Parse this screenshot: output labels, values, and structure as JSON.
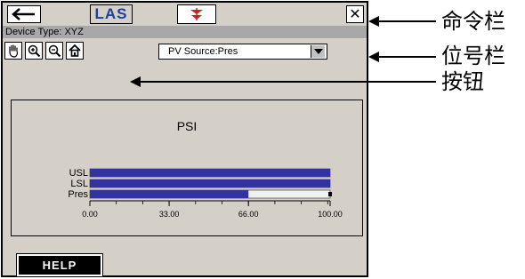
{
  "command_bar": {
    "las_label": "LAS",
    "close_symbol": "✕",
    "back_symbol": "←"
  },
  "position_bar": {
    "device_type": "Device Type: XYZ"
  },
  "toolbar": {
    "pv_source_value": "PV Source:Pres"
  },
  "chart_data": {
    "type": "bar",
    "title": "PSI",
    "categories": [
      "USL",
      "LSL",
      "Pres"
    ],
    "values": [
      100,
      100,
      66
    ],
    "xlim": [
      0,
      100
    ],
    "xticks": [
      "0.00",
      "33.00",
      "66.00",
      "100.00"
    ],
    "xtick_values": [
      0,
      33,
      66,
      100
    ],
    "bar_color": "#3333a0",
    "track_color": "#f0f0f0"
  },
  "help_button": {
    "label": "HELP"
  },
  "callouts": {
    "command_bar": "命令栏",
    "position_bar": "位号栏",
    "buttons": "按钮"
  }
}
